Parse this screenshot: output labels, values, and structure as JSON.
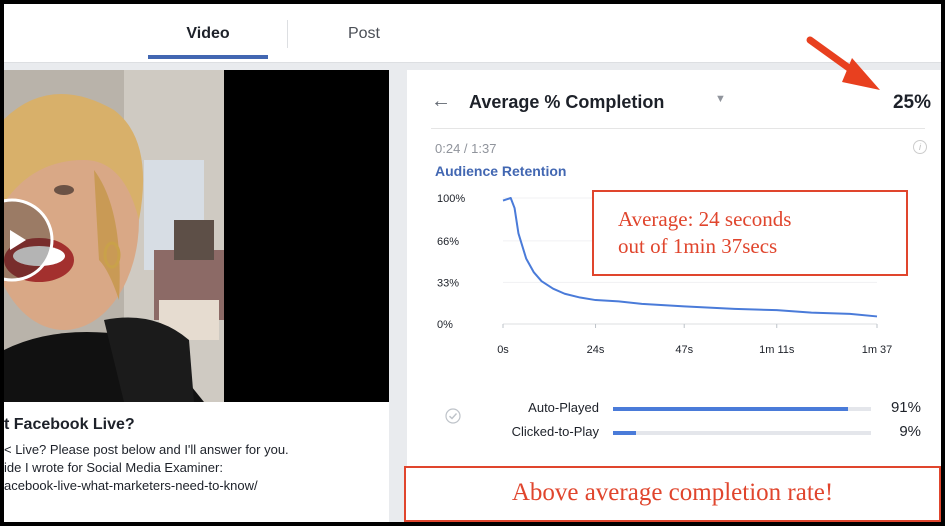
{
  "tabs": {
    "video": "Video",
    "post": "Post"
  },
  "post": {
    "title": "t Facebook Live?",
    "lines": [
      "< Live? Please post below and I'll answer for you.",
      "ide I wrote for Social Media Examiner:",
      "acebook-live-what-marketers-need-to-know/"
    ]
  },
  "insights": {
    "back_icon": "arrow-left-icon",
    "metric_title": "Average % Completion",
    "metric_value": "25%",
    "time_readout": "0:24 / 1:37",
    "retention_heading": "Audience Retention",
    "sources": [
      {
        "label": "Auto-Played",
        "pct": "91%",
        "fraction": 0.91
      },
      {
        "label": "Clicked-to-Play",
        "pct": "9%",
        "fraction": 0.09
      }
    ]
  },
  "annotations": {
    "average_note_line1": "Average: 24 seconds",
    "average_note_line2": "out of 1min 37secs",
    "above_note": "Above average completion rate!",
    "accent": "#e0452d"
  },
  "chart_data": {
    "type": "line",
    "title": "Audience Retention",
    "x_ticks": [
      "0s",
      "24s",
      "47s",
      "1m 11s",
      "1m 37"
    ],
    "y_ticks": [
      "100%",
      "66%",
      "33%",
      "0%"
    ],
    "xlim": [
      0,
      97
    ],
    "ylim": [
      0,
      100
    ],
    "series": [
      {
        "color": "#4a7bd9",
        "x": [
          0,
          2,
          3,
          4,
          6,
          8,
          10,
          13,
          16,
          20,
          24,
          30,
          36,
          47,
          60,
          71,
          80,
          90,
          97
        ],
        "y": [
          98,
          100,
          92,
          72,
          52,
          41,
          34,
          28,
          24,
          21,
          19,
          18,
          16,
          14,
          12,
          11,
          9,
          8,
          6
        ]
      }
    ]
  }
}
